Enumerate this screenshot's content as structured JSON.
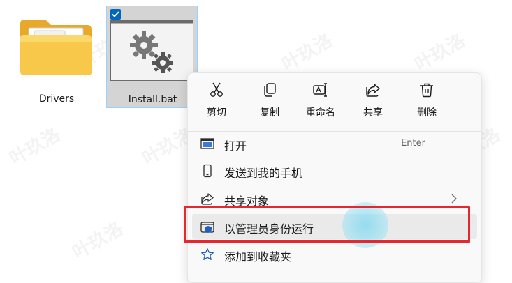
{
  "desktop": {
    "items": [
      {
        "label": "Drivers",
        "type": "folder"
      },
      {
        "label": "Install.bat",
        "type": "batch-file",
        "selected": true
      }
    ]
  },
  "context_menu": {
    "quick_actions": [
      {
        "label": "剪切",
        "icon": "cut-icon"
      },
      {
        "label": "复制",
        "icon": "copy-icon"
      },
      {
        "label": "重命名",
        "icon": "rename-icon"
      },
      {
        "label": "共享",
        "icon": "share-icon"
      },
      {
        "label": "删除",
        "icon": "delete-icon"
      }
    ],
    "items": [
      {
        "label": "打开",
        "shortcut": "Enter",
        "icon": "open-icon"
      },
      {
        "label": "发送到我的手机",
        "icon": "phone-icon"
      },
      {
        "label": "共享对象",
        "icon": "share-with-icon",
        "submenu": true
      },
      {
        "label": "以管理员身份运行",
        "icon": "shield-icon",
        "highlighted": true
      },
      {
        "label": "添加到收藏夹",
        "icon": "star-icon"
      }
    ]
  },
  "watermark": "叶玖洛",
  "colors": {
    "highlight_border": "#e8262b",
    "selection": "#d4d4d4",
    "accent": "#0067c0",
    "folder": "#f4c246"
  }
}
